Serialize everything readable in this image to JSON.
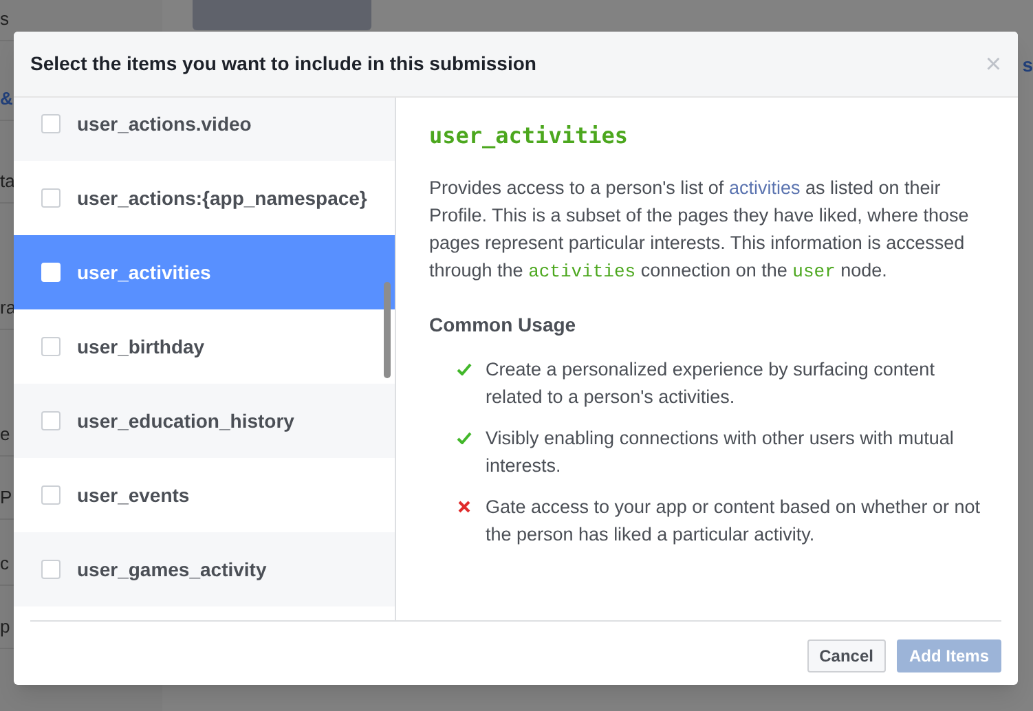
{
  "background": {
    "left_fragments": [
      "s",
      "&",
      "ta",
      "ra",
      "e",
      "P",
      "c",
      "p"
    ],
    "right_link": "s"
  },
  "dialog": {
    "title": "Select the items you want to include in this submission",
    "close": "×",
    "items": [
      {
        "label": "user_actions.video",
        "checked": false,
        "selected": false
      },
      {
        "label": "user_actions:{app_namespace}",
        "checked": false,
        "selected": false
      },
      {
        "label": "user_activities",
        "checked": false,
        "selected": true
      },
      {
        "label": "user_birthday",
        "checked": false,
        "selected": false
      },
      {
        "label": "user_education_history",
        "checked": false,
        "selected": false
      },
      {
        "label": "user_events",
        "checked": false,
        "selected": false
      },
      {
        "label": "user_games_activity",
        "checked": false,
        "selected": false
      }
    ],
    "detail": {
      "title": "user_activities",
      "description": [
        {
          "kind": "text",
          "text": "Provides access to a person's list of "
        },
        {
          "kind": "link",
          "text": "activities"
        },
        {
          "kind": "text",
          "text": " as listed on their Profile. This is a subset of the pages they have liked, where those pages represent particular interests. This information is accessed through the "
        },
        {
          "kind": "code",
          "text": "activities"
        },
        {
          "kind": "text",
          "text": " connection on the "
        },
        {
          "kind": "code",
          "text": "user"
        },
        {
          "kind": "text",
          "text": " node."
        }
      ],
      "usage_heading": "Common Usage",
      "usage": [
        {
          "kind": "do",
          "text": "Create a personalized experience by surfacing content related to a person's activities."
        },
        {
          "kind": "do",
          "text": "Visibly enabling connections with other users with mutual interests."
        },
        {
          "kind": "dont",
          "text": "Gate access to your app or content based on whether or not the person has liked a particular activity."
        }
      ]
    },
    "buttons": [
      {
        "label": "Cancel",
        "disabled": false
      },
      {
        "label": "Add Items",
        "disabled": true
      }
    ]
  }
}
